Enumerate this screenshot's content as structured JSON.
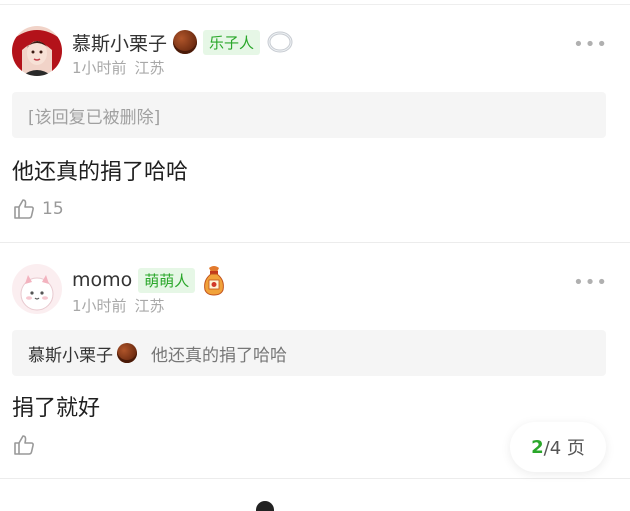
{
  "comments": [
    {
      "username": "慕斯小栗子",
      "tag": "乐子人",
      "time": "1小时前",
      "location": "江苏",
      "quote_text": "[该回复已被删除]",
      "body": "他还真的捐了哈哈",
      "likes": "15",
      "badge_icons": [
        "chestnut-icon",
        "ring-badge-icon"
      ]
    },
    {
      "username": "momo",
      "tag": "萌萌人",
      "time": "1小时前",
      "location": "江苏",
      "quote_name": "慕斯小栗子",
      "quote_text": "他还真的捐了哈哈",
      "body": "捐了就好",
      "likes": "",
      "badge_icons": [
        "lucky-bag-icon"
      ]
    }
  ],
  "pager": {
    "current": "2",
    "total": "/4 页"
  },
  "colors": {
    "tag_green": "#2aa72a",
    "tag_bg": "#e6f7e6",
    "meta_gray": "#a8a8a8"
  }
}
